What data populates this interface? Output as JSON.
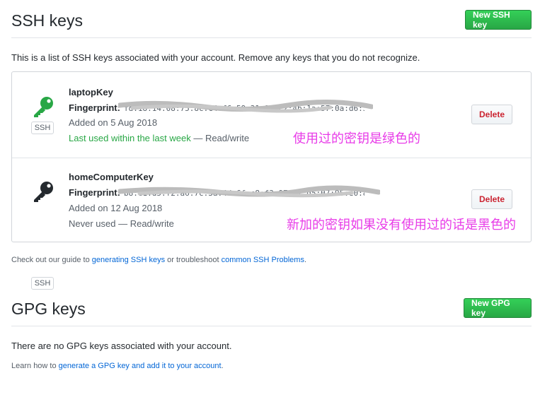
{
  "ssh": {
    "heading": "SSH keys",
    "new_button": "New SSH key",
    "intro": "This is a list of SSH keys associated with your account. Remove any keys that you do not recognize.",
    "keys": [
      {
        "title": "laptopKey",
        "fingerprint_label": "Fingerprint:",
        "fingerprint_value": "fd:18:14:08:75:8c:c4:f6:59:31:9d:c2:4b:1a:57:0a:d6:35",
        "added": "Added on 5 Aug 2018",
        "last_used": "Last used within the last week",
        "access": " — Read/write",
        "badge": "SSH",
        "delete_label": "Delete",
        "icon": "key-icon",
        "icon_color": "#28a745"
      },
      {
        "title": "homeComputerKey",
        "fingerprint_label": "Fingerprint:",
        "fingerprint_value": "b8:e1:d5:f2:a6:7c:3a:4d:6f:c8:f3:97:a7:d5:07:95:e0:8a",
        "added": "Added on 12 Aug 2018",
        "last_used": "Never used",
        "access": " — Read/write",
        "badge": "SSH",
        "delete_label": "Delete",
        "icon": "key-icon",
        "icon_color": "#24292e"
      }
    ],
    "guide": {
      "prefix": "Check out our guide to ",
      "link1": "generating SSH keys",
      "middle": " or troubleshoot ",
      "link2": "common SSH Problems",
      "suffix": "."
    }
  },
  "annotations": {
    "green_note": "使用过的密钥是绿色的",
    "black_note": "新加的密钥如果没有使用过的话是黑色的"
  },
  "gpg": {
    "heading": "GPG keys",
    "new_button": "New GPG key",
    "empty": "There are no GPG keys associated with your account.",
    "learn": {
      "prefix": "Learn how to ",
      "link": "generate a GPG key and add it to your account",
      "suffix": "."
    }
  },
  "colors": {
    "green_button": "#28a745",
    "delete_text": "#cb2431",
    "link": "#0366d6",
    "annotation": "#e83ce8"
  }
}
